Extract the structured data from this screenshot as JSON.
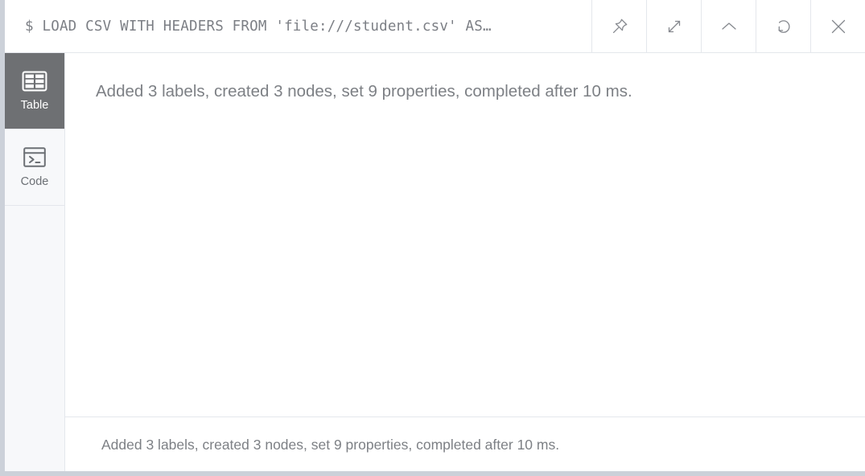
{
  "window": {
    "background_color": "#ccd1d9",
    "card_color": "#ffffff"
  },
  "header": {
    "prompt_symbol": "$",
    "query_text": "$ LOAD CSV WITH HEADERS FROM 'file:///student.csv' AS…",
    "query_full_visible": "LOAD CSV WITH HEADERS FROM 'file:///student.csv' AS…",
    "text_color": "#7c7f85",
    "buttons": [
      {
        "name": "pin-button",
        "icon": "pin-icon",
        "label": "Pin"
      },
      {
        "name": "expand-button",
        "icon": "expand-icon",
        "label": "Fullscreen"
      },
      {
        "name": "collapse-button",
        "icon": "chevron-up-icon",
        "label": "Collapse"
      },
      {
        "name": "rerun-button",
        "icon": "refresh-icon",
        "label": "Rerun"
      },
      {
        "name": "close-button",
        "icon": "close-icon",
        "label": "Close"
      }
    ]
  },
  "sidebar": {
    "active_background": "#6e7073",
    "inactive_background": "#f7f8fa",
    "items": [
      {
        "label": "Table",
        "icon": "table-icon",
        "active": true
      },
      {
        "label": "Code",
        "icon": "code-icon",
        "active": false
      }
    ]
  },
  "main": {
    "result_message": "Added 3 labels, created 3 nodes, set 9 properties, completed after 10 ms."
  },
  "footer": {
    "status_message": "Added 3 labels, created 3 nodes, set 9 properties, completed after 10 ms."
  }
}
